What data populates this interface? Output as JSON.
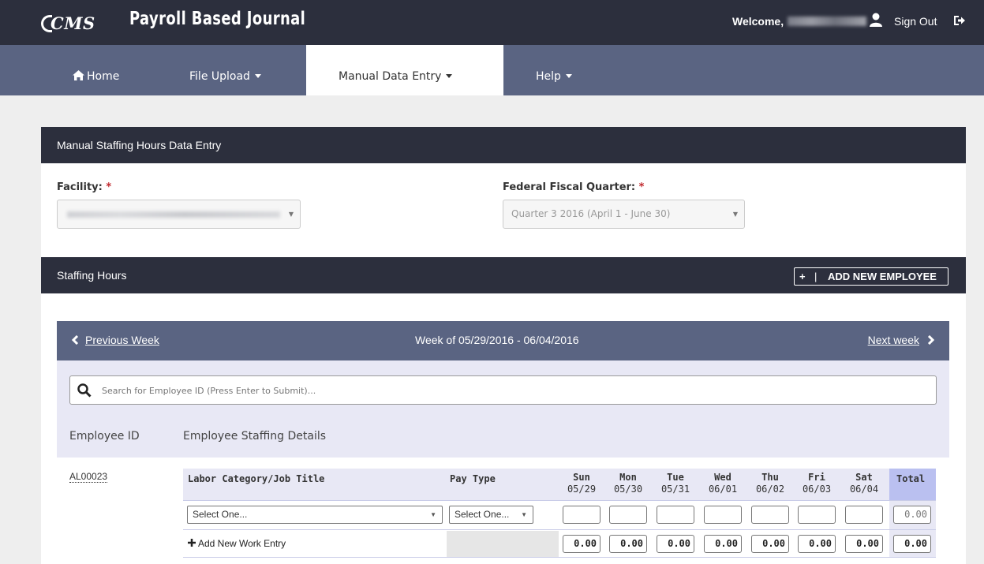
{
  "header": {
    "logo_text": "CMS",
    "app_title": "Payroll Based Journal",
    "welcome_label": "Welcome,",
    "sign_out_label": "Sign Out"
  },
  "nav": {
    "items": [
      {
        "label": "Home",
        "icon": "home-icon",
        "active": false
      },
      {
        "label": "File Upload",
        "active": false
      },
      {
        "label": "Manual Data Entry",
        "active": true
      },
      {
        "label": "Help",
        "active": false
      }
    ]
  },
  "entry_panel": {
    "title": "Manual Staffing Hours Data Entry",
    "facility_label": "Facility:",
    "quarter_label": "Federal Fiscal Quarter:",
    "required_mark": "*",
    "quarter_value": "Quarter 3 2016 (April 1 - June 30)"
  },
  "staffing_panel": {
    "title": "Staffing Hours",
    "add_employee_label": "ADD NEW EMPLOYEE",
    "add_employee_sep": "|",
    "add_employee_plus": "+"
  },
  "week_nav": {
    "prev_label": "Previous Week",
    "title": "Week of 05/29/2016 - 06/04/2016",
    "next_label": "Next week"
  },
  "search": {
    "placeholder": "Search for Employee ID (Press Enter to Submit)..."
  },
  "table": {
    "employee_id_header": "Employee ID",
    "details_header": "Employee Staffing Details",
    "labor_header": "Labor Category/Job Title",
    "pay_header": "Pay Type",
    "total_header": "Total",
    "days": [
      {
        "name": "Sun",
        "date": "05/29"
      },
      {
        "name": "Mon",
        "date": "05/30"
      },
      {
        "name": "Tue",
        "date": "05/31"
      },
      {
        "name": "Wed",
        "date": "06/01"
      },
      {
        "name": "Thu",
        "date": "06/02"
      },
      {
        "name": "Fri",
        "date": "06/03"
      },
      {
        "name": "Sat",
        "date": "06/04"
      }
    ],
    "employee_id": "AL00023",
    "labor_select": "Select One...",
    "pay_select": "Select One...",
    "row_total": "0.00",
    "add_work_label": "Add New Work Entry",
    "day_totals": [
      "0.00",
      "0.00",
      "0.00",
      "0.00",
      "0.00",
      "0.00",
      "0.00"
    ],
    "grand_total": "0.00"
  },
  "colors": {
    "topbar": "#2c2f3d",
    "nav": "#5a6482",
    "accent_total": "#bac0f0",
    "required": "#c0282d"
  }
}
